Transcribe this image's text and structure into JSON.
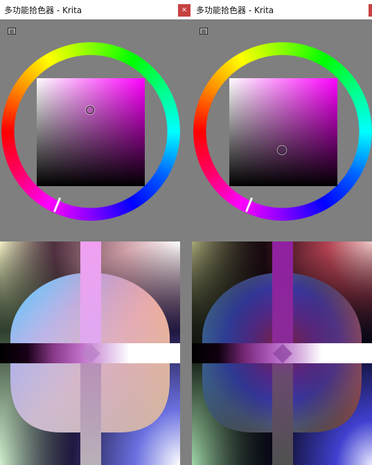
{
  "windows": [
    {
      "title": "多功能拾色器 - Krita"
    },
    {
      "title": "多功能拾色器 - Krita"
    }
  ],
  "close_button": {
    "label": "×"
  },
  "colors": {
    "hue_magenta": "#ff00ff",
    "panel_bg": "#7f7f7f",
    "close_red": "#c74141"
  }
}
